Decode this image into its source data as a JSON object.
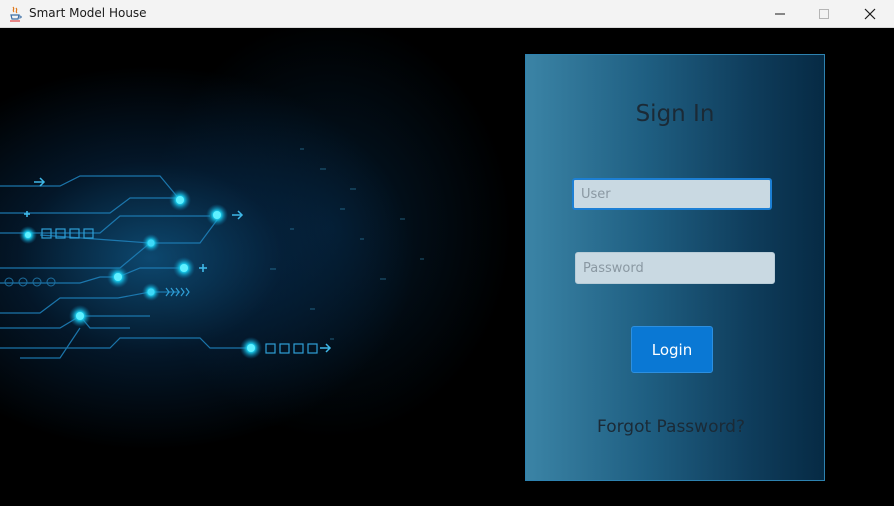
{
  "window": {
    "title": "Smart Model House",
    "icon": "java-cup-icon"
  },
  "login": {
    "heading": "Sign In",
    "user_placeholder": "User",
    "password_placeholder": "Password",
    "login_label": "Login",
    "forgot_label": "Forgot Password?"
  },
  "colors": {
    "accent": "#0a78d4",
    "panel_left": "#3b84a6",
    "panel_right": "#062a44",
    "circuit_glow": "#19d4f5"
  }
}
